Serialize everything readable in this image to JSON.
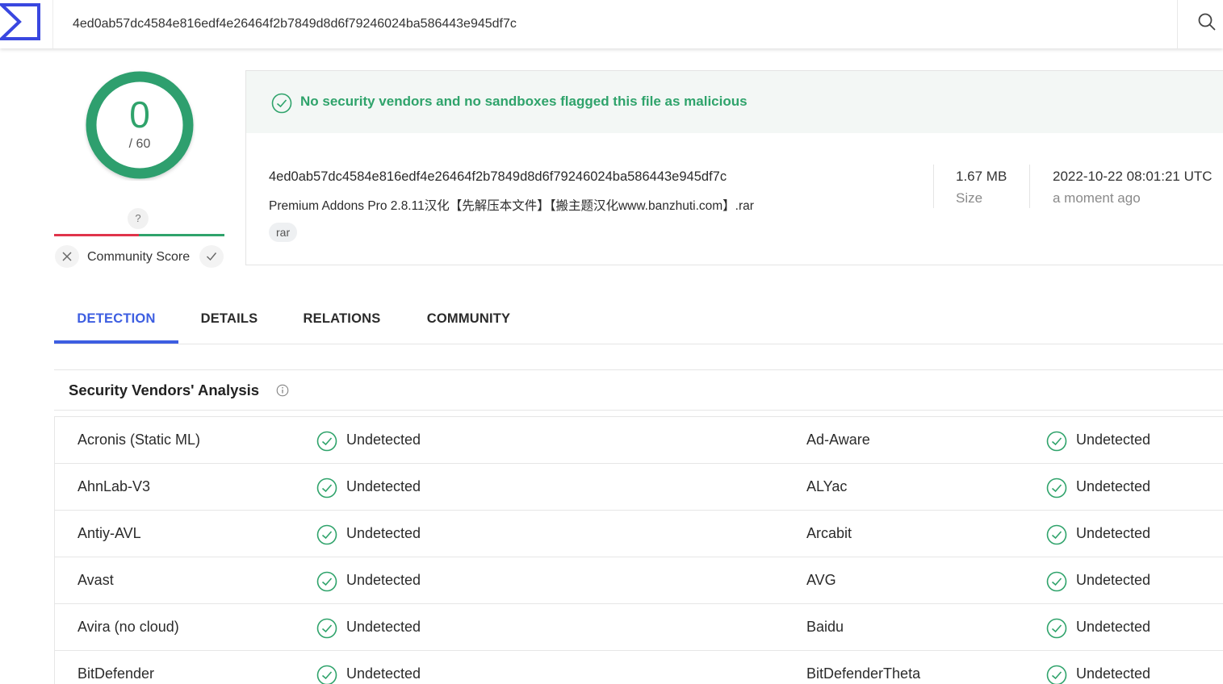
{
  "header": {
    "search_value": "4ed0ab57dc4584e816edf4e26464f2b7849d8d6f79246024ba586443e945df7c"
  },
  "score": {
    "value": "0",
    "total": "/ 60",
    "community_unknown": "?",
    "community_label": "Community Score"
  },
  "summary": {
    "banner": "No security vendors and no sandboxes flagged this file as malicious",
    "hash": "4ed0ab57dc4584e816edf4e26464f2b7849d8d6f79246024ba586443e945df7c",
    "file_name": "Premium Addons Pro 2.8.11汉化【先解压本文件】【搬主题汉化www.banzhuti.com】.rar",
    "tag": "rar",
    "size_value": "1.67 MB",
    "size_label": "Size",
    "date_value": "2022-10-22 08:01:21 UTC",
    "date_label": "a moment ago"
  },
  "tabs": [
    {
      "label": "DETECTION"
    },
    {
      "label": "DETAILS"
    },
    {
      "label": "RELATIONS"
    },
    {
      "label": "COMMUNITY"
    }
  ],
  "vendors": {
    "title": "Security Vendors' Analysis",
    "rows": [
      {
        "left_name": "Acronis (Static ML)",
        "left_result": "Undetected",
        "right_name": "Ad-Aware",
        "right_result": "Undetected"
      },
      {
        "left_name": "AhnLab-V3",
        "left_result": "Undetected",
        "right_name": "ALYac",
        "right_result": "Undetected"
      },
      {
        "left_name": "Antiy-AVL",
        "left_result": "Undetected",
        "right_name": "Arcabit",
        "right_result": "Undetected"
      },
      {
        "left_name": "Avast",
        "left_result": "Undetected",
        "right_name": "AVG",
        "right_result": "Undetected"
      },
      {
        "left_name": "Avira (no cloud)",
        "left_result": "Undetected",
        "right_name": "Baidu",
        "right_result": "Undetected"
      },
      {
        "left_name": "BitDefender",
        "left_result": "Undetected",
        "right_name": "BitDefenderTheta",
        "right_result": "Undetected"
      }
    ]
  },
  "colors": {
    "accent": "#3d5ee1",
    "clean": "#2fa36b",
    "negative": "#e0344b"
  },
  "icons": [
    "virustotal-logo",
    "search-icon",
    "check-circle-icon",
    "close-icon",
    "check-icon",
    "info-icon"
  ]
}
